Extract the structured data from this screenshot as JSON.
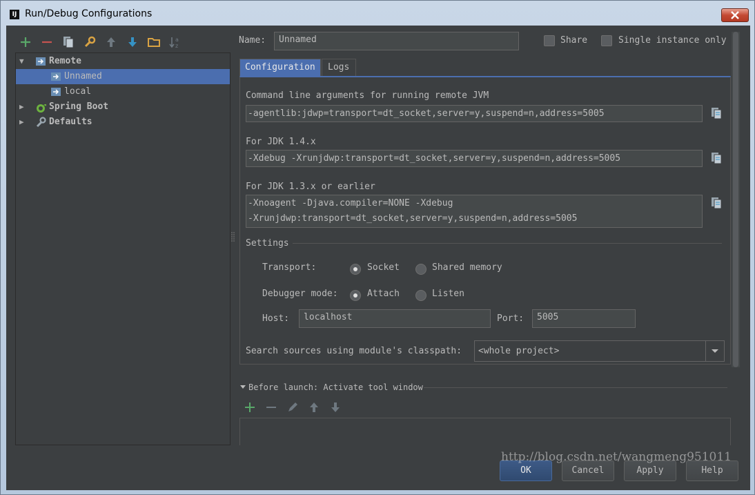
{
  "window": {
    "title": "Run/Debug Configurations",
    "app_icon_text": "IJ"
  },
  "toolbar_icons": [
    "add-icon",
    "remove-icon",
    "copy-icon",
    "wrench-icon",
    "move-up-icon",
    "move-down-icon",
    "folder-icon",
    "sort-icon"
  ],
  "tree": {
    "items": [
      {
        "label": "Remote",
        "level": 0,
        "expanded": true,
        "bold": true,
        "icon": "remote-icon"
      },
      {
        "label": "Unnamed",
        "level": 1,
        "selected": true,
        "icon": "remote-config-icon"
      },
      {
        "label": "local",
        "level": 1,
        "icon": "remote-config-icon"
      },
      {
        "label": "Spring Boot",
        "level": 0,
        "expanded": false,
        "bold": true,
        "icon": "spring-boot-icon"
      },
      {
        "label": "Defaults",
        "level": 0,
        "expanded": false,
        "bold": true,
        "icon": "wrench-icon"
      }
    ]
  },
  "name_field": {
    "label": "Name:",
    "value": "Unnamed"
  },
  "share": {
    "label": "Share",
    "checked": false
  },
  "single_instance": {
    "label": "Single instance only",
    "checked": false
  },
  "tabs": [
    {
      "label": "Configuration",
      "active": true
    },
    {
      "label": "Logs",
      "active": false
    }
  ],
  "config": {
    "cmd_label": "Command line arguments for running remote JVM",
    "cmd_value": "-agentlib:jdwp=transport=dt_socket,server=y,suspend=n,address=5005",
    "jdk14_label": "For JDK 1.4.x",
    "jdk14_value": "-Xdebug -Xrunjdwp:transport=dt_socket,server=y,suspend=n,address=5005",
    "jdk13_label": "For JDK 1.3.x or earlier",
    "jdk13_line1": "-Xnoagent -Djava.compiler=NONE -Xdebug",
    "jdk13_line2": "-Xrunjdwp:transport=dt_socket,server=y,suspend=n,address=5005"
  },
  "settings": {
    "title": "Settings",
    "transport_label": "Transport:",
    "transport_options": [
      {
        "label": "Socket",
        "selected": true
      },
      {
        "label": "Shared memory",
        "selected": false
      }
    ],
    "debugger_mode_label": "Debugger mode:",
    "debugger_mode_options": [
      {
        "label": "Attach",
        "selected": true
      },
      {
        "label": "Listen",
        "selected": false
      }
    ],
    "host_label": "Host:",
    "host_value": "localhost",
    "port_label": "Port:",
    "port_value": "5005",
    "classpath_label": "Search sources using module's classpath:",
    "classpath_value": "<whole project>"
  },
  "before_launch": {
    "title": "Before launch: Activate tool window",
    "toolbar_icons": [
      "add-icon",
      "remove-icon",
      "edit-icon",
      "move-up-icon",
      "move-down-icon"
    ]
  },
  "buttons": {
    "ok": "OK",
    "cancel": "Cancel",
    "apply": "Apply",
    "help": "Help"
  },
  "watermark": "http://blog.csdn.net/wangmeng951011",
  "colors": {
    "background": "#3c3f41",
    "selection": "#4b6eaf",
    "text": "#bbbbbb",
    "green": "#59a869",
    "blue": "#3592c4",
    "red": "#c75450"
  }
}
